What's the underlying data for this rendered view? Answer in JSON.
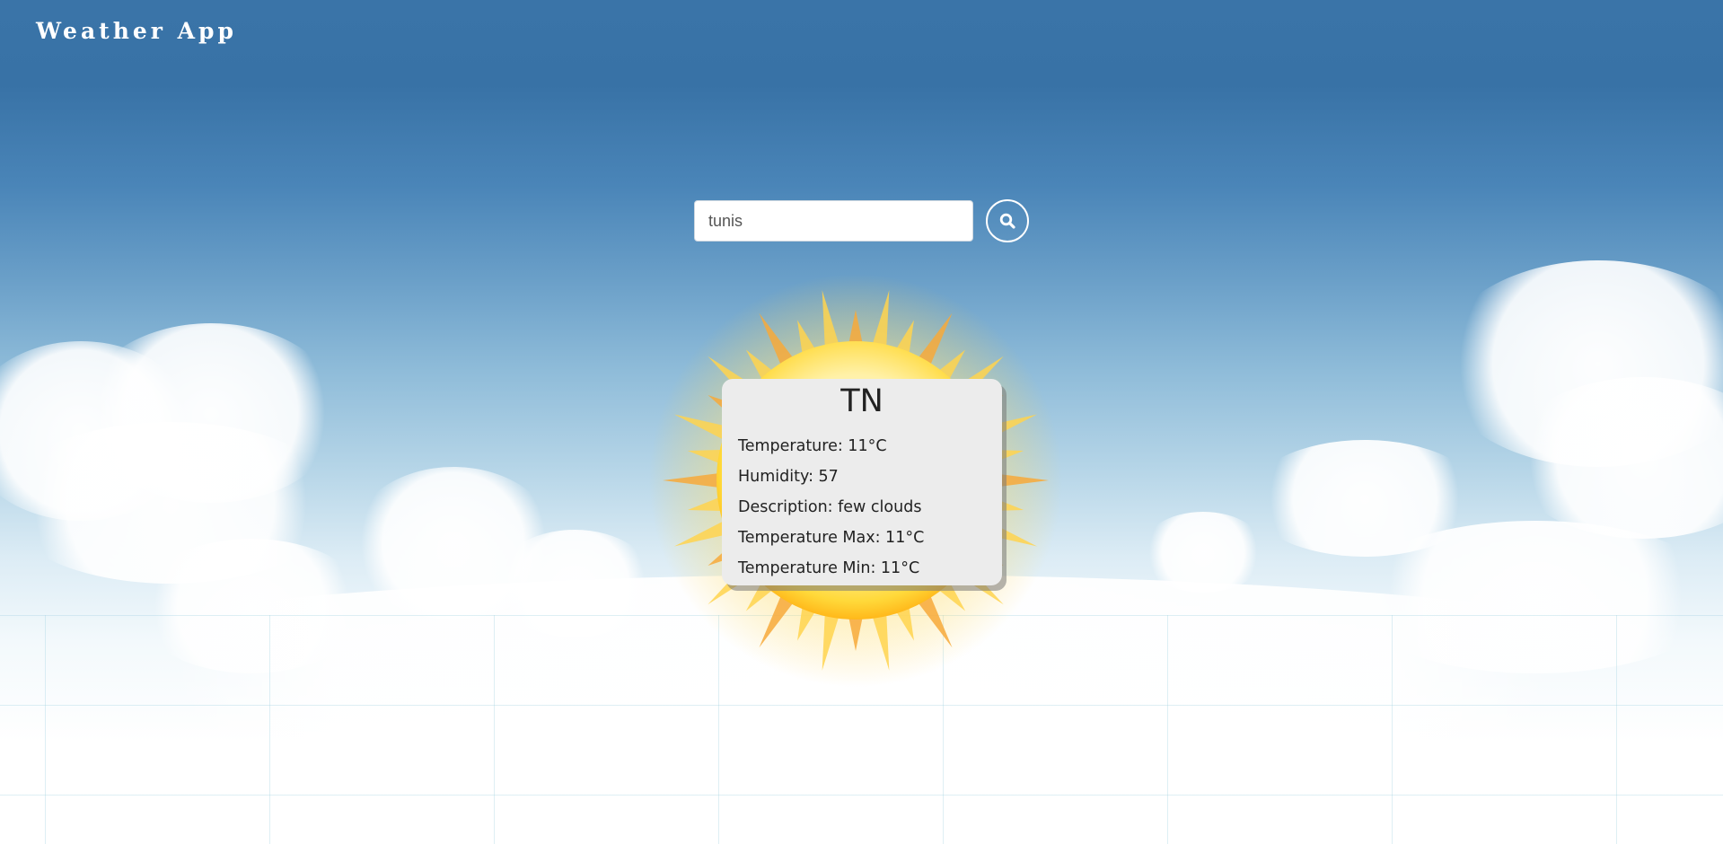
{
  "header": {
    "title": "Weather App"
  },
  "search": {
    "value": "tunis",
    "placeholder": ""
  },
  "icons": {
    "search_button": "search-icon",
    "weather": "sun-icon"
  },
  "weather_card": {
    "country": "TN",
    "temperature": "Temperature: 11°C",
    "humidity": "Humidity: 57",
    "description": "Description: few clouds",
    "temperature_max": "Temperature Max: 11°C",
    "temperature_min": "Temperature Min: 11°C"
  },
  "colors": {
    "sky_top": "#3872a6",
    "card_background": "#ececec",
    "text": "#222222"
  }
}
